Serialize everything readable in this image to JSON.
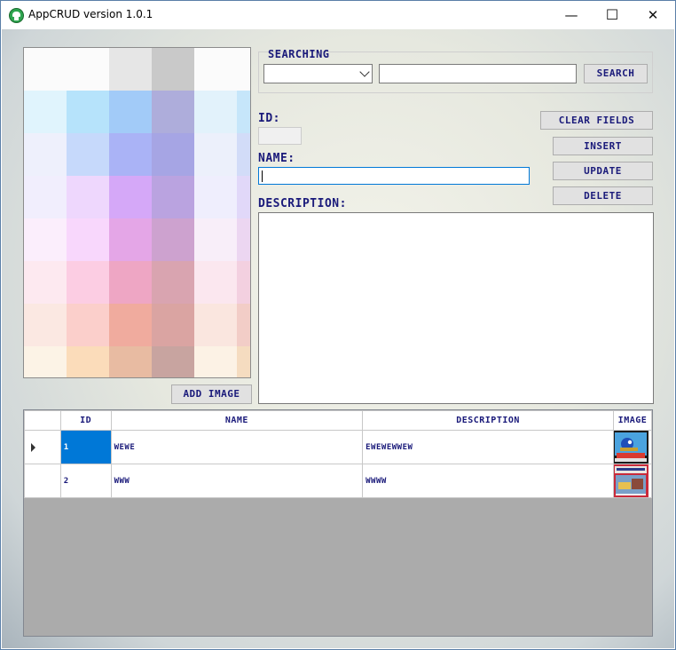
{
  "window": {
    "title": "AppCRUD version 1.0.1",
    "controls": {
      "minimize": "—",
      "maximize": "☐",
      "close": "✕"
    }
  },
  "image_panel": {
    "add_image_label": "ADD IMAGE",
    "mosaic_colors": [
      [
        "#fbfbfb",
        "#fbfbfb",
        "#e6e6e6",
        "#c9c9c9",
        "#fbfbfb",
        "#fbfbfb"
      ],
      [
        "#e0f4fd",
        "#b6e3fb",
        "#a2cbf8",
        "#aeaddb",
        "#e2f2fb",
        "#c6e6fa"
      ],
      [
        "#eef0fc",
        "#c6d9fb",
        "#aab3f6",
        "#a6a5e4",
        "#ecf0fb",
        "#d2dcf8"
      ],
      [
        "#f1eefd",
        "#eed7fd",
        "#d5a8f8",
        "#baa3e0",
        "#efeefd",
        "#e1d8f9"
      ],
      [
        "#fbeefc",
        "#f8d7fc",
        "#e4a6e7",
        "#cda2cf",
        "#f8eef9",
        "#ecd6f1"
      ],
      [
        "#fde9f0",
        "#fccde3",
        "#eea6c4",
        "#d9a4b0",
        "#fbe7ef",
        "#f3d0e0"
      ],
      [
        "#fbe8e2",
        "#fbcfcb",
        "#f0ab9e",
        "#daa4a2",
        "#fae6df",
        "#f2cdc7"
      ],
      [
        "#fcf3e6",
        "#fbdcba",
        "#e8bba2",
        "#c8a4a0",
        "#fcf2e5",
        "#f5dcc0"
      ]
    ]
  },
  "search": {
    "group_label": "SEARCHING",
    "combo_value": "",
    "query_value": "",
    "button_label": "SEARCH"
  },
  "form": {
    "id_label": "ID:",
    "id_value": "",
    "name_label": "NAME:",
    "name_value": "",
    "description_label": "DESCRIPTION:",
    "description_value": ""
  },
  "actions": {
    "clear_label": "CLEAR FIELDS",
    "insert_label": "INSERT",
    "update_label": "UPDATE",
    "delete_label": "DELETE"
  },
  "table": {
    "columns": [
      "ID",
      "NAME",
      "DESCRIPTION",
      "IMAGE"
    ],
    "rows": [
      {
        "id": "1",
        "name": "WEWE",
        "description": "EWEWEWWEW",
        "image": "sonic-cover",
        "current": true
      },
      {
        "id": "2",
        "name": "WWW",
        "description": "WWWW",
        "image": "racing-cover",
        "current": false
      }
    ]
  },
  "colors": {
    "accent_text": "#1a1a7a",
    "selection": "#0078d7",
    "grid_background": "#ababab"
  }
}
